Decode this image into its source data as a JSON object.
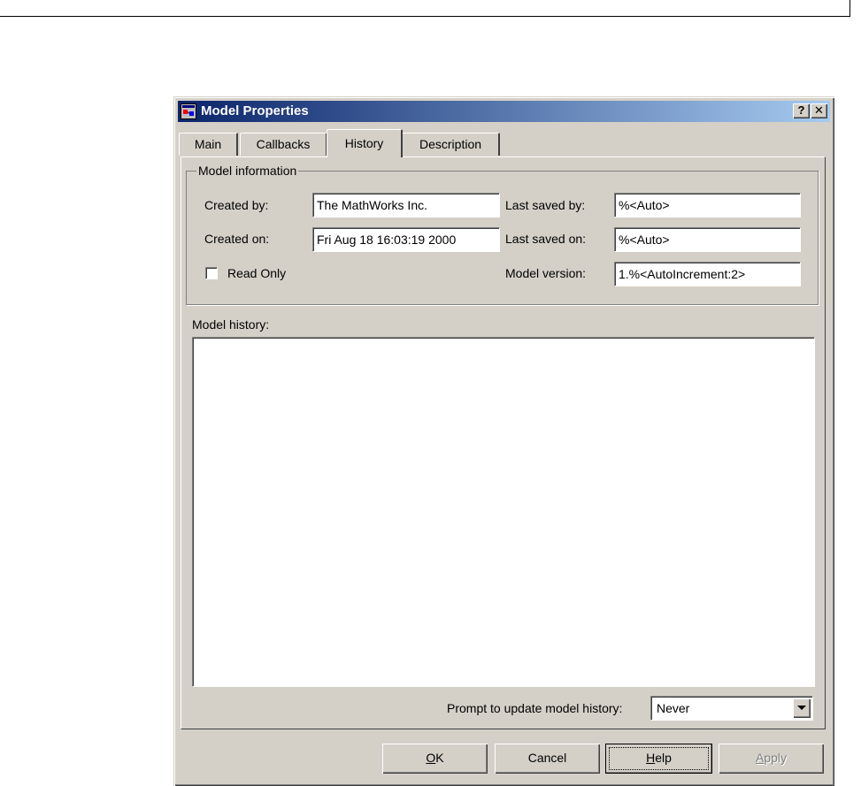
{
  "window": {
    "title": "Model Properties",
    "help_glyph": "?",
    "close_glyph": "✕"
  },
  "tabs": [
    {
      "label": "Main",
      "active": false
    },
    {
      "label": "Callbacks",
      "active": false
    },
    {
      "label": "History",
      "active": true
    },
    {
      "label": "Description",
      "active": false
    }
  ],
  "model_information": {
    "group_label": "Model information",
    "created_by_label": "Created by:",
    "created_by_value": "The MathWorks Inc.",
    "created_on_label": "Created on:",
    "created_on_value": "Fri Aug 18 16:03:19 2000",
    "read_only_label": "Read Only",
    "read_only_checked": false,
    "last_saved_by_label": "Last saved by:",
    "last_saved_by_value": "%<Auto>",
    "last_saved_on_label": "Last saved on:",
    "last_saved_on_value": "%<Auto>",
    "model_version_label": "Model version:",
    "model_version_value": "1.%<AutoIncrement:2>"
  },
  "history": {
    "label": "Model history:",
    "value": ""
  },
  "prompt": {
    "label": "Prompt to update model history:",
    "selected": "Never"
  },
  "buttons": {
    "ok_first": "O",
    "ok_rest": "K",
    "cancel": "Cancel",
    "help_first": "H",
    "help_rest": "elp",
    "apply_first": "A",
    "apply_rest": "pply"
  },
  "colors": {
    "title_gradient_start": "#0a246a",
    "title_gradient_end": "#a6caf0",
    "face": "#d4d0c8"
  }
}
